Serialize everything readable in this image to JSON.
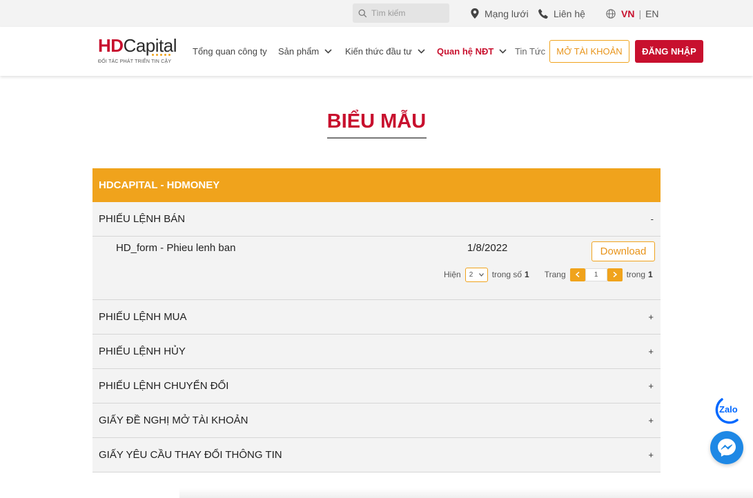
{
  "topbar": {
    "search_placeholder": "Tìm kiếm",
    "network": "Mạng lưới",
    "contact": "Liên hệ",
    "lang_vn": "VN",
    "lang_sep": "|",
    "lang_en": "EN"
  },
  "logo": {
    "hd": "HD",
    "capital": "Capital",
    "tagline": "ĐỐI TÁC PHÁT TRIỂN TIN CẬY"
  },
  "nav": {
    "items": [
      {
        "label": "Tổng quan công ty"
      },
      {
        "label": "Sản phẩm"
      },
      {
        "label": "Kiến thức đầu tư"
      },
      {
        "label": "Quan hệ NĐT"
      },
      {
        "label": "Tin Tức"
      }
    ],
    "open_account": "MỞ TÀI KHOẢN",
    "login": "ĐĂNG NHẬP"
  },
  "page": {
    "title": "BIỂU MẪU"
  },
  "accordion": {
    "header": "HDCAPITAL - HDMONEY",
    "sections": [
      {
        "title": "PHIẾU LỆNH BÁN",
        "toggle": "-"
      },
      {
        "title": "PHIẾU LỆNH MUA",
        "toggle": "+"
      },
      {
        "title": "PHIẾU LỆNH HỦY",
        "toggle": "+"
      },
      {
        "title": "PHIẾU LỆNH CHUYỂN ĐỔI",
        "toggle": "+"
      },
      {
        "title": "GIẤY ĐỀ NGHỊ MỞ TÀI KHOẢN",
        "toggle": "+"
      },
      {
        "title": "GIẤY YÊU CẦU THAY ĐỔI THÔNG TIN",
        "toggle": "+"
      }
    ],
    "file": {
      "name": "HD_form - Phieu lenh ban",
      "date": "1/8/2022",
      "download": "Download"
    },
    "pager": {
      "show_label": "Hiện",
      "page_size": "2",
      "of_label": "trong số",
      "total": "1",
      "page_label": "Trang",
      "current_page": "1",
      "of_pages_label": "trong",
      "total_pages": "1"
    }
  },
  "floating": {
    "zalo": "Zalo"
  },
  "colors": {
    "brand_red": "#c8102e",
    "accent_orange": "#f0a31c",
    "messenger_blue": "#1e88e5",
    "zalo_blue": "#0068ff"
  }
}
